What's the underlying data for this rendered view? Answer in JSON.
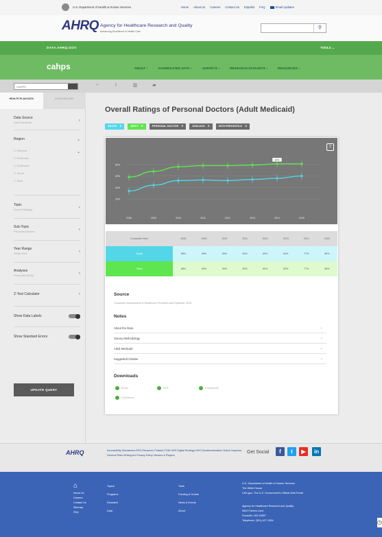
{
  "hhs": {
    "text": "U.S. Department of Health & Human Services"
  },
  "toplinks": [
    "Home",
    "About Us",
    "Careers",
    "Contact Us",
    "Español",
    "FAQ",
    "Email Updates"
  ],
  "ahrq": {
    "logo": "AHRQ",
    "name": "Agency for Healthcare Research and Quality",
    "tagline": "Advancing Excellence in Health Care"
  },
  "search": {
    "placeholder": "",
    "icon": "search-icon"
  },
  "dotgov": {
    "label": "DATA.AHRQ.GOV",
    "tools": "TOOLS ⌄"
  },
  "cahps": {
    "logo": "cahps",
    "nav": [
      "ABOUT ›",
      "AGGREGATED DATA ›",
      "SURVEYS ›",
      "RESEARCH DATASETS ›",
      "RESOURCES ›"
    ]
  },
  "toolbar": {
    "select": "CAHPS"
  },
  "sidebar": {
    "tabs": [
      "HEALTH PLAN DATA",
      "CLINICIAN DATA"
    ],
    "data_source": {
      "label": "Data Source",
      "value": "Adult Medicaid"
    },
    "region": {
      "label": "Region",
      "options": [
        "Midwest",
        "Northeast",
        "Northwest",
        "South",
        "West"
      ],
      "checked": [
        "South",
        "West"
      ]
    },
    "topic": {
      "label": "Topic",
      "value": "Overall Ratings"
    },
    "subtopic": {
      "label": "Sub-Topic",
      "value": "Personal Doctors"
    },
    "year_range": {
      "label": "Year Range",
      "value": "2008-2015"
    },
    "analyses": {
      "label": "Analyses",
      "value": "Percentile (90th)"
    },
    "ztest": {
      "label": "Z-Test Calculator"
    },
    "show_data_labels": "Show Data Labels",
    "show_standard_errors": "Show Standard Errors",
    "update_button": "UPDATE QUERY"
  },
  "main": {
    "title": "Overall Ratings of Personal Doctors (Adult Medicaid)",
    "tags": [
      {
        "label": "SOUTH",
        "color": "#53d7e8"
      },
      {
        "label": "WEST",
        "color": "#5ee650"
      },
      {
        "label": "PERSONAL DOCTOR",
        "color": "#6a6a6a"
      },
      {
        "label": "2008-2015",
        "color": "#6a6a6a"
      },
      {
        "label": "90TH PERCENTILE",
        "color": "#6a6a6a"
      }
    ]
  },
  "chart_data": {
    "type": "line",
    "x": [
      "2008",
      "2009",
      "2010",
      "2011",
      "2012",
      "2013",
      "2014",
      "2015"
    ],
    "yticks": [
      "80%",
      "60%",
      "40%",
      "20%"
    ],
    "ylim": [
      0,
      100
    ],
    "series": [
      {
        "name": "South",
        "color": "#53d7e8",
        "values": [
          34,
          44,
          52,
          53,
          52,
          54,
          56,
          60
        ]
      },
      {
        "name": "West",
        "color": "#5ee650",
        "values": [
          58,
          68,
          76,
          78,
          78,
          79,
          81,
          81
        ]
      }
    ],
    "tooltip": "81%",
    "grid": true
  },
  "table": {
    "header": [
      "Composite /Item",
      "2008",
      "2009",
      "2010",
      "2011",
      "2012",
      "2013",
      "2014",
      "2015"
    ],
    "rows": [
      {
        "label": "South",
        "values": [
          "68%",
          "69%",
          "59%",
          "63%",
          "60%",
          "64%",
          "77%",
          "85%"
        ]
      },
      {
        "label": "West",
        "values": [
          "68%",
          "69%",
          "59%",
          "63%",
          "60%",
          "59%",
          "77%",
          "85%"
        ]
      }
    ]
  },
  "source": {
    "heading": "Source",
    "text": "Consumer Assessment of Healthcare Providers and Systems, 2015"
  },
  "notes": {
    "heading": "Notes",
    "items": [
      "About the Data",
      "Survey Methodology",
      "Adult Medicaid",
      "Suggested Citation"
    ]
  },
  "downloads": {
    "heading": "Downloads",
    "items": [
      "Excel",
      "PDF",
      "Powerpoint",
      "Chartbook"
    ]
  },
  "footer": {
    "logo": "AHRQ",
    "links": "Accessibility  Disclaimers  EEO  Electronic Policies  FOIA  HHS Digital Strategy  HHS Nondiscrimination Notice  Inspector General  Plain Writing Act  Privacy Policy  Viewers & Players",
    "social": "Get Social",
    "col1": [
      "About Us",
      "Careers",
      "Contact Us",
      "Sitemap",
      "FAQ"
    ],
    "col2": [
      "Topics",
      "Programs",
      "Research",
      "Data"
    ],
    "col3": [
      "Tools",
      "Funding & Grants",
      "News & Events",
      "About"
    ],
    "col4": [
      "U.S. Department of Health & Human Services",
      "The White House",
      "USA.gov: The U.S. Government's Official Web Portal"
    ],
    "col5": [
      "Agency for Healthcare Research and Quality",
      "5600 Fishers Lane",
      "Rockville, MD 20857",
      "Telephone: (301) 427-1364"
    ]
  }
}
